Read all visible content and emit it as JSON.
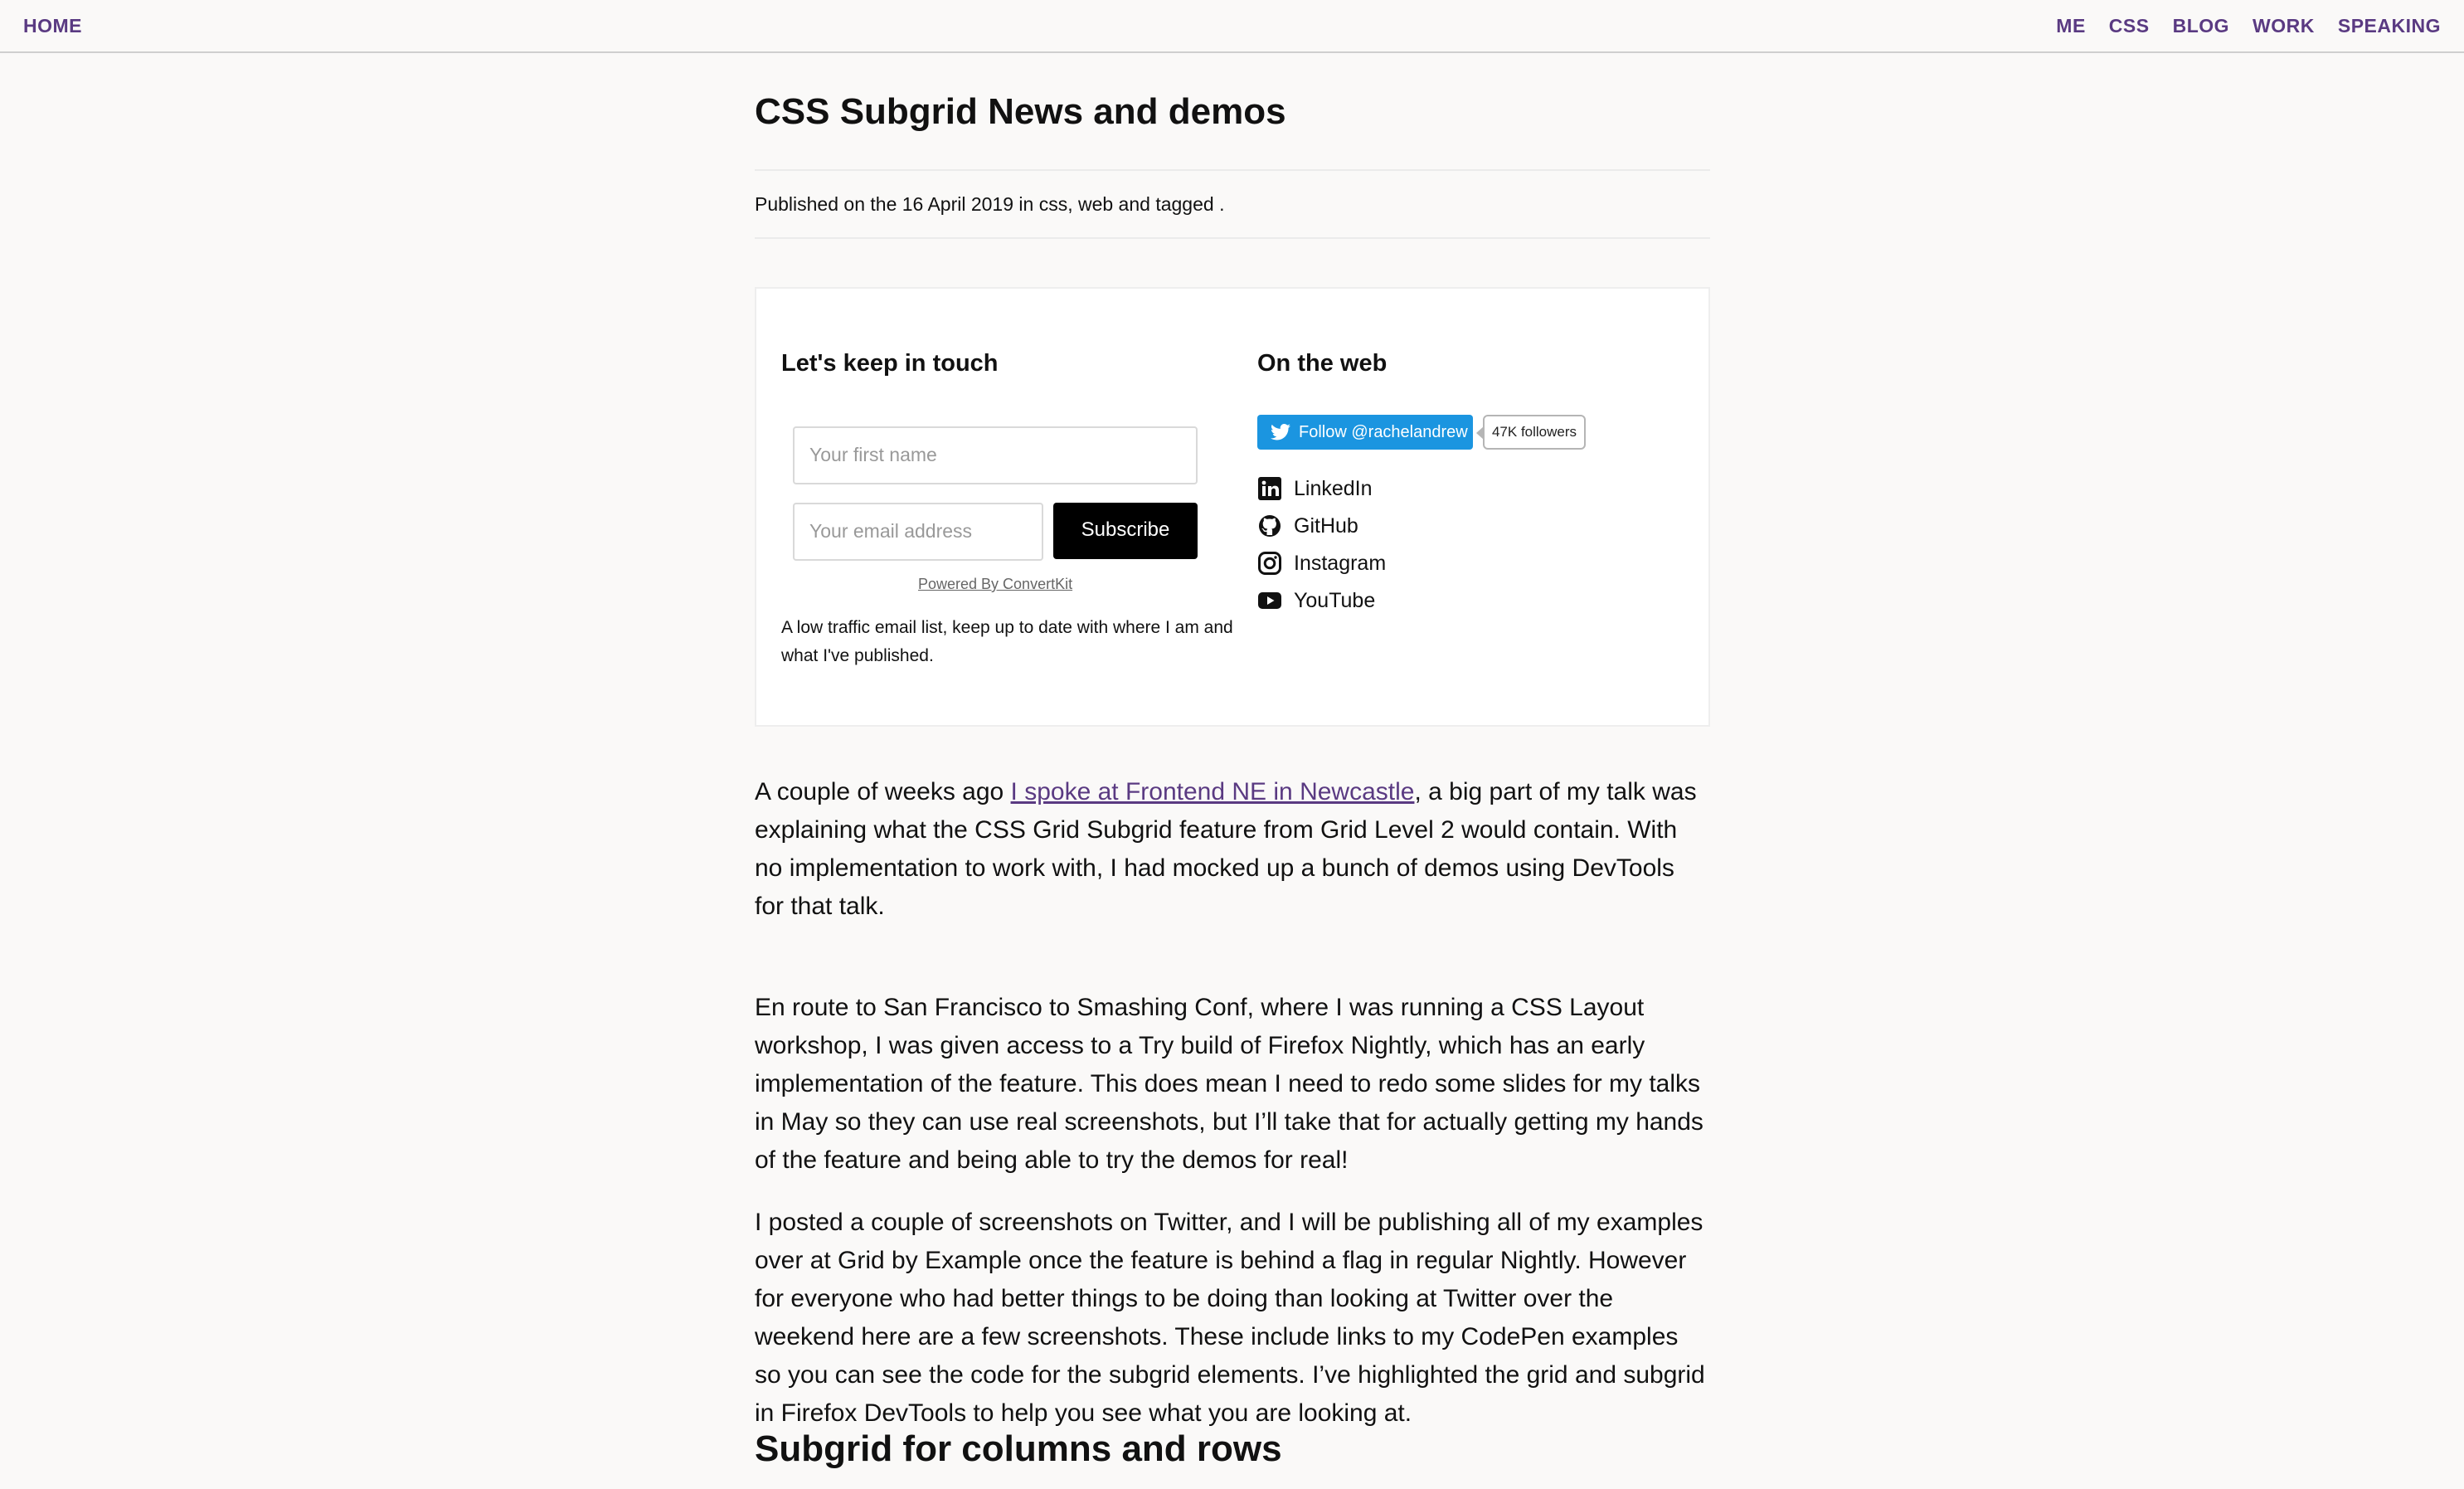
{
  "nav": {
    "home": "HOME",
    "right": [
      "ME",
      "CSS",
      "BLOG",
      "WORK",
      "SPEAKING"
    ]
  },
  "post": {
    "title": "CSS Subgrid News and demos",
    "meta": "Published on the 16 April 2019 in css, web and tagged ."
  },
  "signup": {
    "heading": "Let's keep in touch",
    "first_name_placeholder": "Your first name",
    "email_placeholder": "Your email address",
    "subscribe_label": "Subscribe",
    "powered_by": "Powered By ConvertKit",
    "blurb": "A low traffic email list, keep up to date with where I am and what I've published."
  },
  "web": {
    "heading": "On the web",
    "twitter_follow": "Follow @rachelandrew",
    "twitter_followers": "47K followers",
    "links": [
      {
        "label": "LinkedIn",
        "icon": "linkedin-icon"
      },
      {
        "label": "GitHub",
        "icon": "github-icon"
      },
      {
        "label": "Instagram",
        "icon": "instagram-icon"
      },
      {
        "label": "YouTube",
        "icon": "youtube-icon"
      }
    ]
  },
  "body": {
    "p1_before": "A couple of weeks ago ",
    "p1_link": "I spoke at Frontend NE in Newcastle",
    "p1_after": ", a big part of my talk was explaining what the CSS Grid Subgrid feature from Grid Level 2 would contain. With no implementation to work with, I had mocked up a bunch of demos using DevTools for that talk.",
    "p2": "En route to San Francisco to Smashing Conf, where I was running a CSS Layout workshop, I was given access to a Try build of Firefox Nightly, which has an early implementation of the feature. This does mean I need to redo some slides for my talks in May so they can use real screenshots, but I’ll take that for actually getting my hands of the feature and being able to try the demos for real!",
    "p3": "I posted a couple of screenshots on Twitter, and I will be publishing all of my examples over at Grid by Example once the feature is behind a flag in regular Nightly. However for everyone who had better things to be doing than looking at Twitter over the weekend here are a few screenshots. These include links to my CodePen examples so you can see the code for the subgrid elements. I’ve highlighted the grid and subgrid in Firefox DevTools to help you see what you are looking at.",
    "section_heading": "Subgrid for columns and rows"
  },
  "colors": {
    "accent": "#5a3a82",
    "twitter": "#1b95e0",
    "background": "#faf9f8"
  }
}
